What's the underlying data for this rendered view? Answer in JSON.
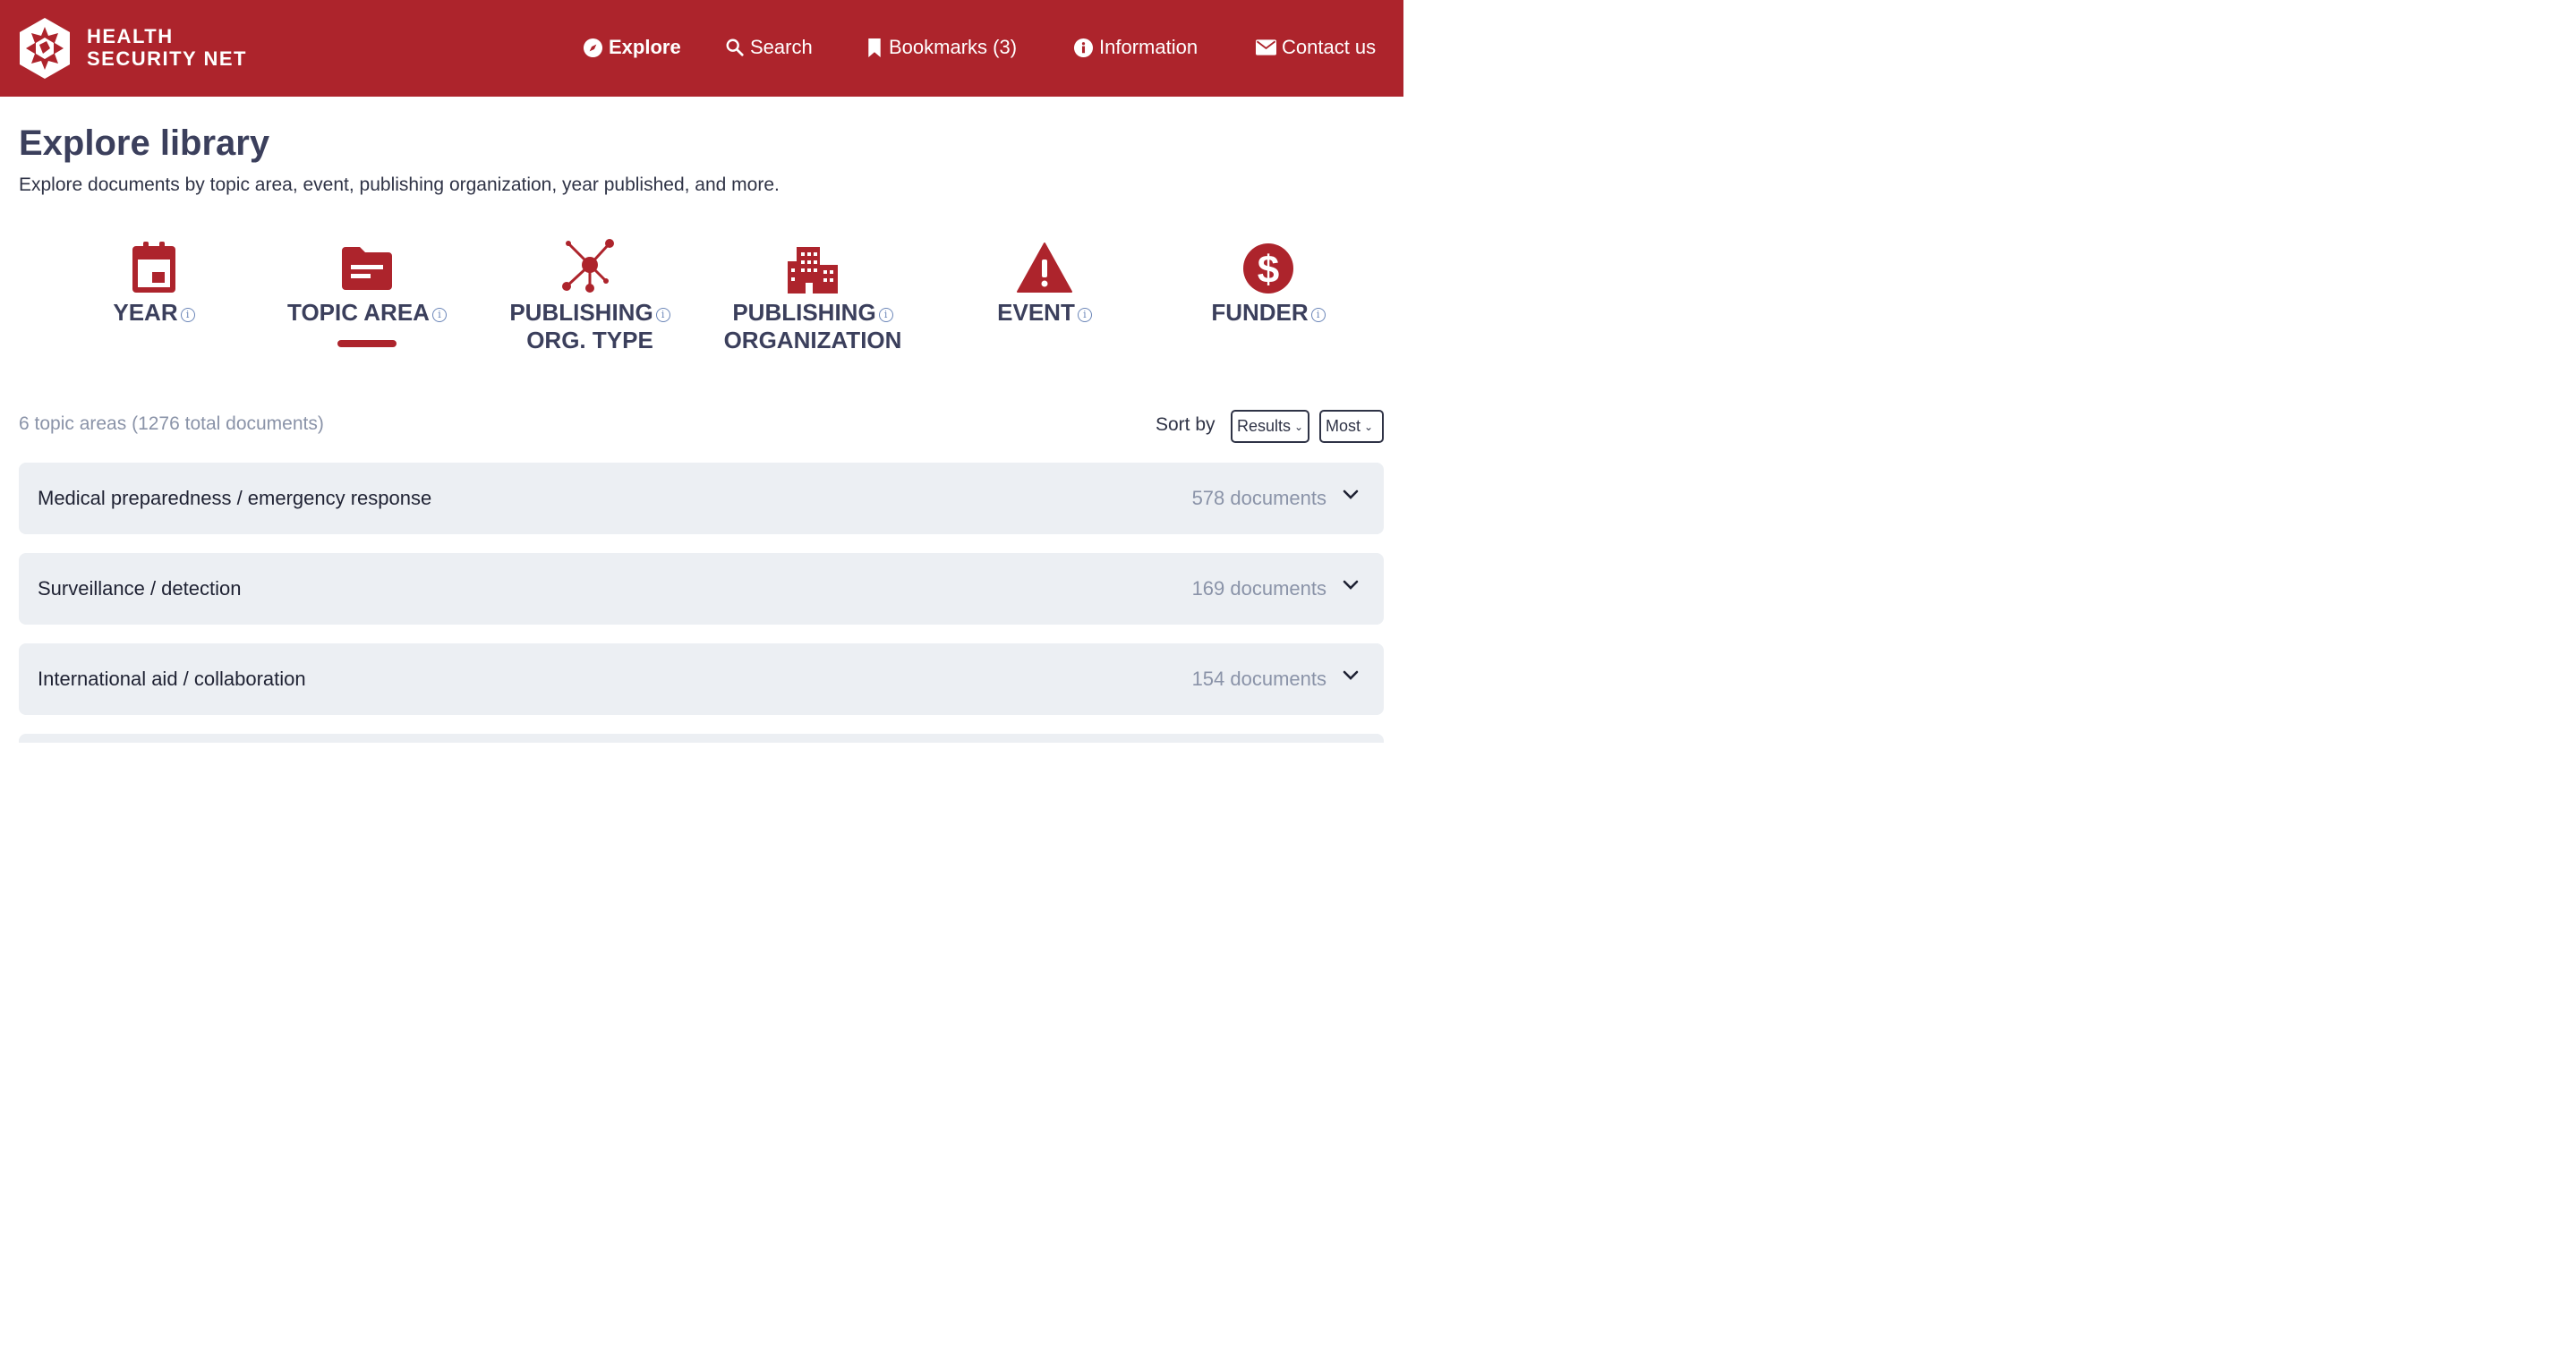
{
  "brand": {
    "line1": "HEALTH",
    "line2": "SECURITY NET"
  },
  "colors": {
    "brand_red": "#ad242c",
    "text_dark": "#3b3f5c",
    "muted": "#8a93a8",
    "row_bg": "#eceff3"
  },
  "nav": [
    {
      "label": "Explore",
      "icon": "compass-icon",
      "active": true
    },
    {
      "label": "Search",
      "icon": "search-icon"
    },
    {
      "label": "Bookmarks (3)",
      "icon": "bookmark-icon"
    },
    {
      "label": "Information",
      "icon": "info-icon"
    },
    {
      "label": "Contact us",
      "icon": "mail-icon"
    }
  ],
  "page": {
    "title": "Explore library",
    "subtitle": "Explore documents by topic area, event, publishing organization, year published, and more."
  },
  "categories": [
    {
      "label": "YEAR",
      "icon": "calendar-icon"
    },
    {
      "label": "TOPIC AREA",
      "icon": "folder-icon",
      "selected": true
    },
    {
      "label_line1": "PUBLISHING",
      "label_line2": "ORG. TYPE",
      "icon": "network-icon"
    },
    {
      "label_line1": "PUBLISHING",
      "label_line2": "ORGANIZATION",
      "icon": "building-icon"
    },
    {
      "label": "EVENT",
      "icon": "warning-icon"
    },
    {
      "label": "FUNDER",
      "icon": "dollar-icon"
    }
  ],
  "summary": "6 topic areas (1276 total documents)",
  "sort": {
    "label": "Sort by",
    "field": "Results",
    "order": "Most"
  },
  "topics": [
    {
      "title": "Medical preparedness / emergency response",
      "count": "578 documents"
    },
    {
      "title": "Surveillance / detection",
      "count": "169 documents"
    },
    {
      "title": "International aid / collaboration",
      "count": "154 documents"
    }
  ]
}
